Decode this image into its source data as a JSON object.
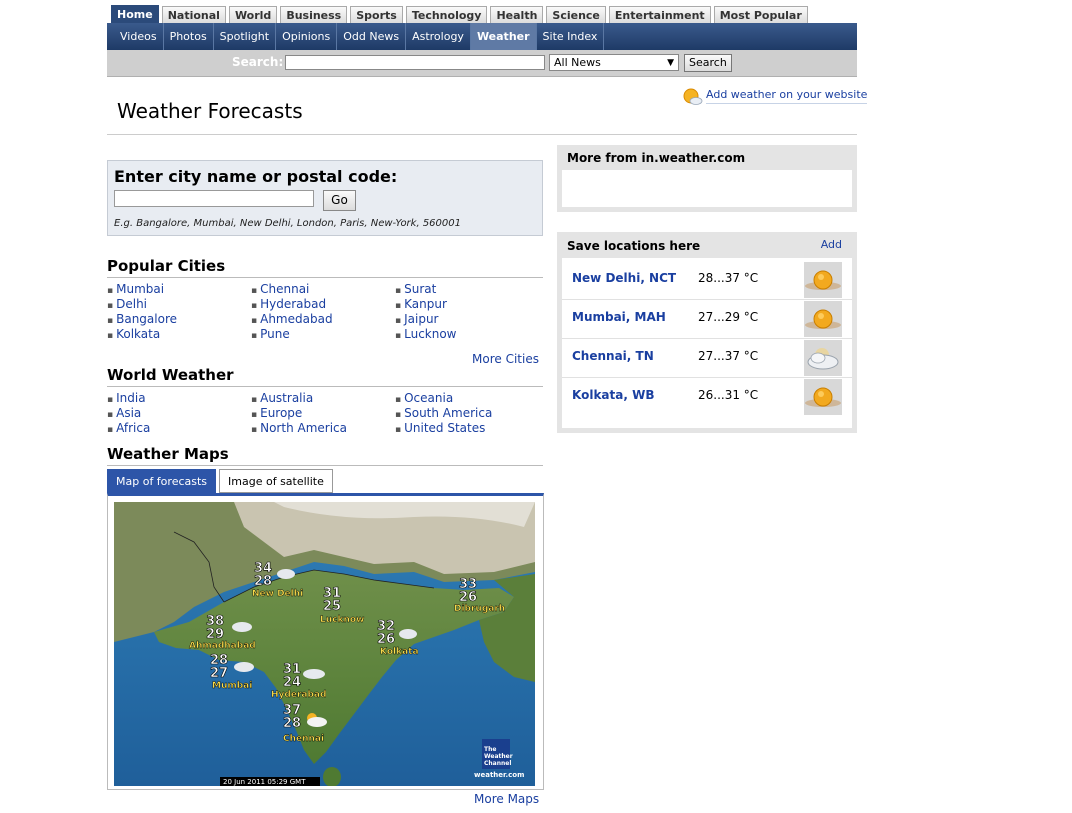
{
  "nav": {
    "tabs": [
      "Home",
      "National",
      "World",
      "Business",
      "Sports",
      "Technology",
      "Health",
      "Science",
      "Entertainment",
      "Most Popular"
    ],
    "sub": [
      "Videos",
      "Photos",
      "Spotlight",
      "Opinions",
      "Odd News",
      "Astrology",
      "Weather",
      "Site Index"
    ]
  },
  "search": {
    "label": "Search:",
    "input_value": "",
    "scope": "All News",
    "button": "Search"
  },
  "page": {
    "title": "Weather Forecasts",
    "add_weather": "Add weather on your website"
  },
  "city_search": {
    "heading": "Enter city name or postal code:",
    "value": "",
    "go": "Go",
    "example": "E.g. Bangalore, Mumbai, New Delhi, London, Paris, New-York, 560001"
  },
  "popular": {
    "title": "Popular Cities",
    "col1": [
      "Mumbai",
      "Delhi",
      "Bangalore",
      "Kolkata"
    ],
    "col2": [
      "Chennai",
      "Hyderabad",
      "Ahmedabad",
      "Pune"
    ],
    "col3": [
      "Surat",
      "Kanpur",
      "Jaipur",
      "Lucknow"
    ],
    "more": "More Cities"
  },
  "world": {
    "title": "World Weather",
    "col1": [
      "India",
      "Asia",
      "Africa"
    ],
    "col2": [
      "Australia",
      "Europe",
      "North America"
    ],
    "col3": [
      "Oceania",
      "South America",
      "United States"
    ]
  },
  "maps": {
    "title": "Weather Maps",
    "tab_forecast": "Map of forecasts",
    "tab_satellite": "Image of satellite",
    "timestamp": "20 Jun 2011 05:29 GMT",
    "logo_lines": [
      "The",
      "Weather",
      "Channel"
    ],
    "logo_url": "weather.com",
    "more": "More Maps",
    "cities": [
      {
        "name": "New Delhi",
        "hi": "34",
        "lo": "28"
      },
      {
        "name": "Lucknow",
        "hi": "31",
        "lo": "25"
      },
      {
        "name": "Dibrugarh",
        "hi": "33",
        "lo": "26"
      },
      {
        "name": "Ahmadhabad",
        "hi": "38",
        "lo": "29"
      },
      {
        "name": "Kolkata",
        "hi": "32",
        "lo": "26"
      },
      {
        "name": "Mumbai",
        "hi": "28",
        "lo": "27"
      },
      {
        "name": "Hyderabad",
        "hi": "31",
        "lo": "24"
      },
      {
        "name": "Chennai",
        "hi": "37",
        "lo": "28"
      }
    ]
  },
  "more_from": {
    "title": "More from in.weather.com"
  },
  "saved": {
    "title": "Save locations here",
    "add": "Add",
    "locations": [
      {
        "name": "New Delhi, NCT",
        "temp": "28...37 °C",
        "icon": "sun-icon"
      },
      {
        "name": "Mumbai, MAH",
        "temp": "27...29 °C",
        "icon": "sun-icon"
      },
      {
        "name": "Chennai, TN",
        "temp": "27...37 °C",
        "icon": "cloudy-icon"
      },
      {
        "name": "Kolkata, WB",
        "temp": "26...31 °C",
        "icon": "sun-icon"
      }
    ]
  },
  "colors": {
    "nav_blue": "#2b4a7a",
    "link_blue": "#1a3fa0",
    "tab_blue": "#2d55a8"
  }
}
